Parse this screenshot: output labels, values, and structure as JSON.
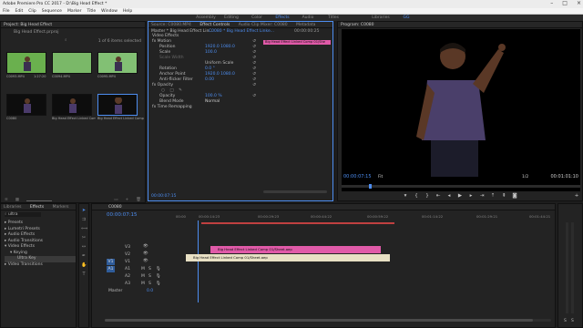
{
  "window": {
    "title": "Adobe Premiere Pro CC 2017 - D:\\Big Head Effect *"
  },
  "menu": [
    "File",
    "Edit",
    "Clip",
    "Sequence",
    "Marker",
    "Title",
    "Window",
    "Help"
  ],
  "workspaces": {
    "tabs": [
      "Assembly",
      "Editing",
      "Color",
      "Effects",
      "Audio",
      "Titles",
      "Libraries",
      "GG"
    ],
    "active": "Effects"
  },
  "project": {
    "header": "Project: Big Head Effect",
    "path": "Big Head Effect.prproj",
    "count": "1 of 6 items selected",
    "thumbs": [
      {
        "label": "C0093.MP4",
        "dur": "1:27:20",
        "bg": "green"
      },
      {
        "label": "C0094.MP4",
        "dur": "",
        "bg": "green"
      },
      {
        "label": "C0095.MP4",
        "dur": "",
        "bg": "green"
      },
      {
        "label": "C0080",
        "dur": "",
        "bg": "dark"
      },
      {
        "label": "Big Head Effect Linked Comp 01",
        "dur": "",
        "bg": "dark"
      },
      {
        "label": "Big Head Effect Linked Comp 01/Sh",
        "dur": "",
        "bg": "dark"
      }
    ]
  },
  "effect_controls": {
    "tabs": [
      "Source: C0080.MP4",
      "Effect Controls",
      "Audio Clip Mixer: C0080",
      "Metadata"
    ],
    "master": "Master * Big Head Effect Lin...",
    "clip": "C0080 * Big Head Effect Linke...",
    "timecode": "00:00:00:25",
    "clip_label": "Big Head Effect Linked Comp 01/She",
    "section": "Video Effects",
    "rows": [
      {
        "name": "fx  Motion",
        "value": ""
      },
      {
        "name": "Position",
        "value": "1920.0   1080.0"
      },
      {
        "name": "Scale",
        "value": "100.0"
      },
      {
        "name": "Scale Width",
        "value": ""
      },
      {
        "name": "",
        "value": "Uniform Scale"
      },
      {
        "name": "Rotation",
        "value": "0.0 °"
      },
      {
        "name": "Anchor Point",
        "value": "1920.0   1080.0"
      },
      {
        "name": "Anti-flicker Filter",
        "value": "0.00"
      },
      {
        "name": "fx  Opacity",
        "value": ""
      },
      {
        "name": "Opacity",
        "value": "100.0 %"
      },
      {
        "name": "Blend Mode",
        "value": "Normal"
      },
      {
        "name": "fx  Time Remapping",
        "value": ""
      }
    ],
    "bottom_time": "00:00:07:15"
  },
  "program": {
    "header": "Program: C0080",
    "timecode": "00:00:07:15",
    "fit": "Fit",
    "duration": "00:01:01:10",
    "fraction": "1/2"
  },
  "effects_panel": {
    "tabs": [
      "Libraries",
      "Effects",
      "Markers"
    ],
    "search": "ultra",
    "tree": [
      "Presets",
      "Lumetri Presets",
      "Audio Effects",
      "Audio Transitions",
      "Video Effects",
      "Keying",
      "Ultra Key",
      "Video Transitions"
    ]
  },
  "timeline": {
    "header": "C0080",
    "timecode": "00:00:07:15",
    "ruler": [
      "00:00",
      "00:00:14:23",
      "00:00:29:23",
      "00:00:44:22",
      "00:00:59:22",
      "00:01:14:22",
      "00:01:29:21",
      "00:01:44:21"
    ],
    "tracks": [
      "V3",
      "V2",
      "V1",
      "A1",
      "A2",
      "A3",
      "Master"
    ],
    "master_val": "0.0",
    "clips": [
      {
        "label": "Big Head Effect Linked Comp 01/Sheet.aep",
        "color": "#e05aa8"
      },
      {
        "label": "Big Head Effect Linked Comp 01/Sheet.aep",
        "color": "#e8e0c4"
      }
    ]
  },
  "colors": {
    "accent": "#4d8df0",
    "green_screen": "#6ab04e",
    "pink_clip": "#e05aa8",
    "cream_clip": "#e8e0c4"
  }
}
